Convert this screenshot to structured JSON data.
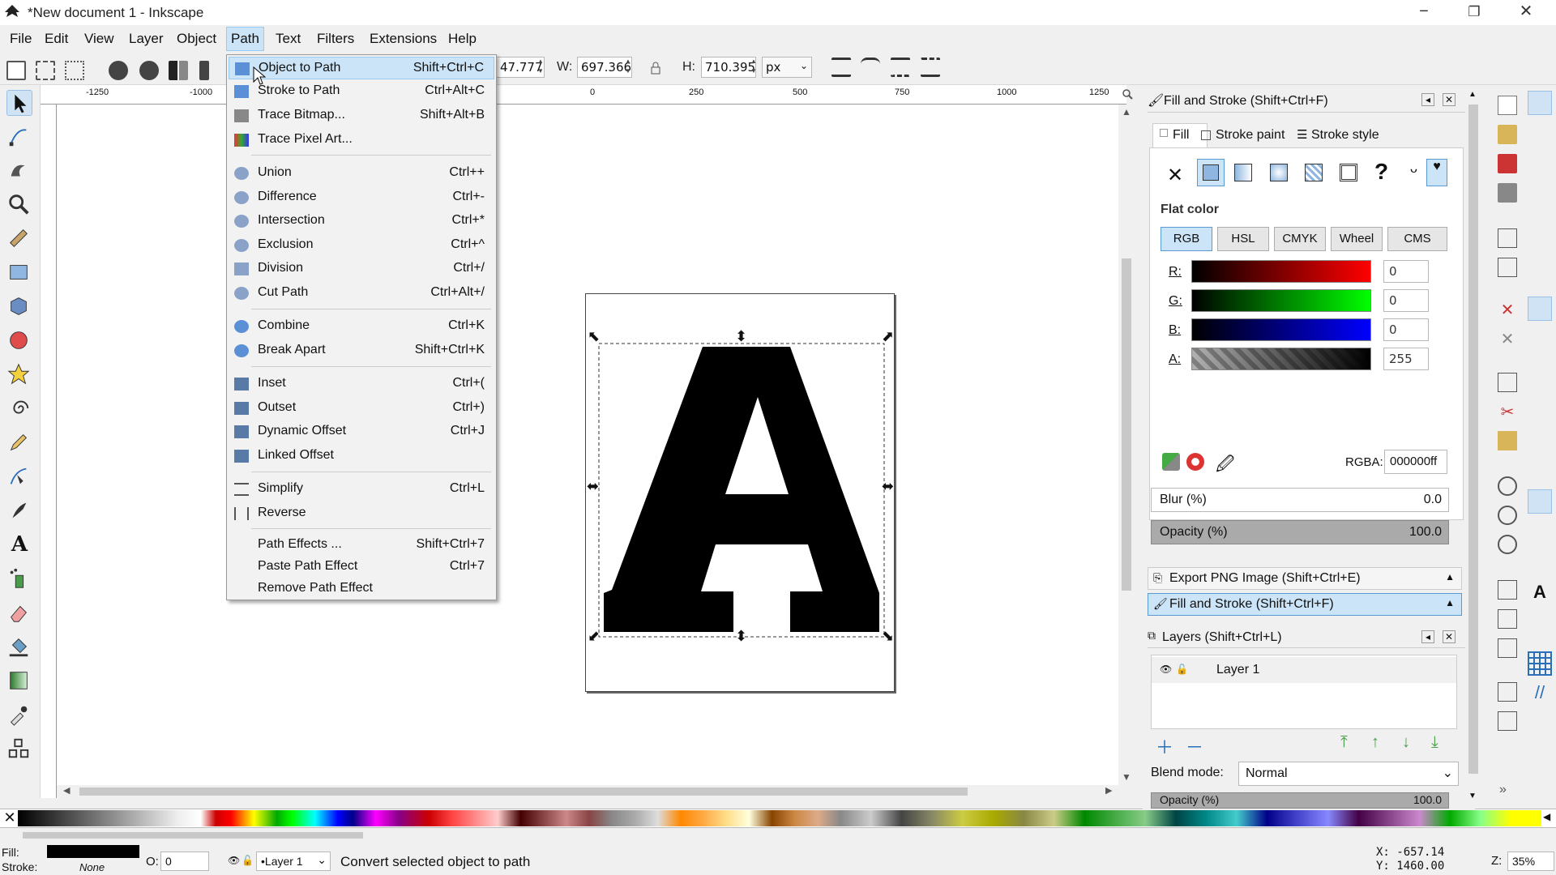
{
  "window": {
    "title": "*New document 1 - Inkscape",
    "minimize": "−",
    "restore": "❐",
    "close": "✕"
  },
  "menubar": [
    "File",
    "Edit",
    "View",
    "Layer",
    "Object",
    "Path",
    "Text",
    "Filters",
    "Extensions",
    "Help"
  ],
  "toolbar": {
    "x_value": "47.777",
    "w_label": "W:",
    "w_value": "697.366",
    "h_label": "H:",
    "h_value": "710.395",
    "unit": "px"
  },
  "ruler_labels": [
    "-1250",
    "-1000",
    "0",
    "250",
    "500",
    "750",
    "1000",
    "1250"
  ],
  "path_menu": {
    "items": [
      {
        "label": "Object to Path",
        "shortcut": "Shift+Ctrl+C"
      },
      {
        "label": "Stroke to Path",
        "shortcut": "Ctrl+Alt+C"
      },
      {
        "label": "Trace Bitmap...",
        "shortcut": "Shift+Alt+B"
      },
      {
        "label": "Trace Pixel Art...",
        "shortcut": ""
      },
      {
        "label": "Union",
        "shortcut": "Ctrl++"
      },
      {
        "label": "Difference",
        "shortcut": "Ctrl+-"
      },
      {
        "label": "Intersection",
        "shortcut": "Ctrl+*"
      },
      {
        "label": "Exclusion",
        "shortcut": "Ctrl+^"
      },
      {
        "label": "Division",
        "shortcut": "Ctrl+/"
      },
      {
        "label": "Cut Path",
        "shortcut": "Ctrl+Alt+/"
      },
      {
        "label": "Combine",
        "shortcut": "Ctrl+K"
      },
      {
        "label": "Break Apart",
        "shortcut": "Shift+Ctrl+K"
      },
      {
        "label": "Inset",
        "shortcut": "Ctrl+("
      },
      {
        "label": "Outset",
        "shortcut": "Ctrl+)"
      },
      {
        "label": "Dynamic Offset",
        "shortcut": "Ctrl+J"
      },
      {
        "label": "Linked Offset",
        "shortcut": ""
      },
      {
        "label": "Simplify",
        "shortcut": "Ctrl+L"
      },
      {
        "label": "Reverse",
        "shortcut": ""
      },
      {
        "label": "Path Effects ...",
        "shortcut": "Shift+Ctrl+7"
      },
      {
        "label": "Paste Path Effect",
        "shortcut": "Ctrl+7"
      },
      {
        "label": "Remove Path Effect",
        "shortcut": ""
      }
    ]
  },
  "canvas": {
    "glyph": "A"
  },
  "fill_stroke": {
    "title": "Fill and Stroke (Shift+Ctrl+F)",
    "tabs": [
      "Fill",
      "Stroke paint",
      "Stroke style"
    ],
    "flat_color": "Flat color",
    "modes": [
      "RGB",
      "HSL",
      "CMYK",
      "Wheel",
      "CMS"
    ],
    "channels": [
      {
        "label": "R:",
        "value": "0"
      },
      {
        "label": "G:",
        "value": "0"
      },
      {
        "label": "B:",
        "value": "0"
      },
      {
        "label": "A:",
        "value": "255"
      }
    ],
    "rgba_label": "RGBA:",
    "rgba_value": "000000ff",
    "blur_label": "Blur (%)",
    "blur_value": "0.0",
    "opacity_label": "Opacity (%)",
    "opacity_value": "100.0"
  },
  "dock_tabs": {
    "export": "Export PNG Image (Shift+Ctrl+E)",
    "fill": "Fill and Stroke (Shift+Ctrl+F)"
  },
  "layers": {
    "title": "Layers (Shift+Ctrl+L)",
    "layer_name": "Layer 1",
    "blend_label": "Blend mode:",
    "blend_value": "Normal",
    "opacity_label": "Opacity (%)",
    "opacity_value": "100.0"
  },
  "status": {
    "fill_label": "Fill:",
    "stroke_label": "Stroke:",
    "stroke_value": "None",
    "o_label": "O:",
    "o_value": "0",
    "layer": "•Layer 1",
    "message": "Convert selected object to path",
    "x": "X: -657.14",
    "y": "Y: 1460.00",
    "z_label": "Z:",
    "zoom": "35%"
  },
  "colors": {
    "accent": "#cce4f7",
    "accent_border": "#99c9ef"
  }
}
